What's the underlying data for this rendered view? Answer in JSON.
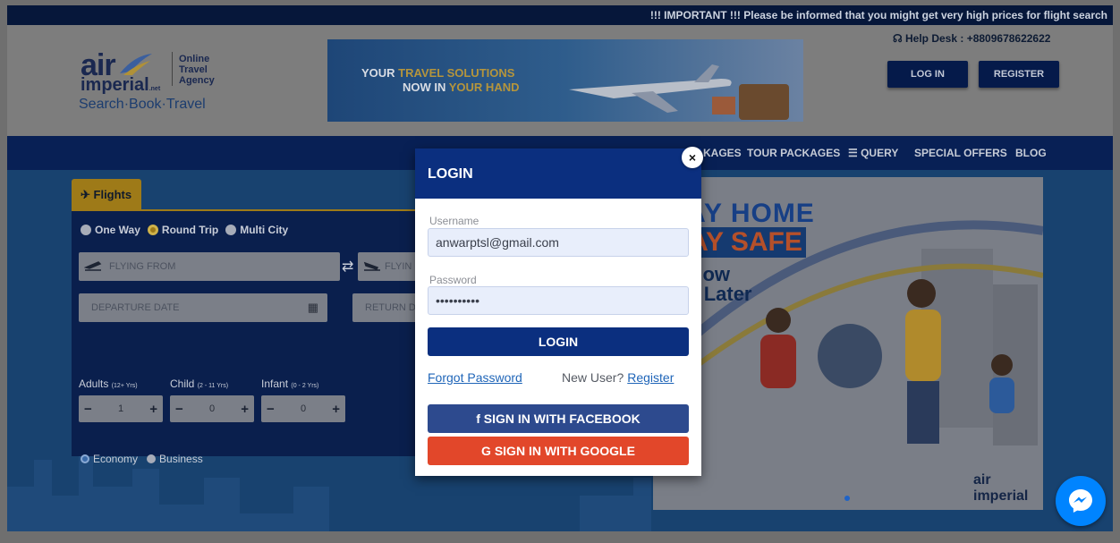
{
  "ticker": "!!! IMPORTANT !!! Please be informed that you might get very high prices for flight search",
  "header": {
    "logo": {
      "air": "air",
      "imperial": "imperial",
      "net": ".net",
      "ota": [
        "Online",
        "Travel",
        "Agency"
      ],
      "tagline": "Search·Book·Travel"
    },
    "banner": {
      "line1_a": "YOUR ",
      "line1_b": "TRAVEL SOLUTIONS",
      "line2_a": "NOW IN ",
      "line2_b": "YOUR HAND"
    },
    "helpdesk": "Help Desk : +8809678622622",
    "login_label": "LOG IN",
    "register_label": "REGISTER"
  },
  "nav": {
    "items": [
      "KAGES",
      "TOUR PACKAGES",
      "QUERY",
      "SPECIAL OFFERS",
      "BLOG"
    ]
  },
  "search": {
    "tab_label": "Flights",
    "trip_types": [
      "One Way",
      "Round Trip",
      "Multi City"
    ],
    "selected_trip": "Round Trip",
    "flying_from_placeholder": "FLYING FROM",
    "flying_to_placeholder": "FLYIN",
    "departure_placeholder": "DEPARTURE DATE",
    "return_placeholder": "RETURN D",
    "pax": {
      "adults_label": "Adults",
      "adults_range": "(12+ Yrs)",
      "adults_value": "1",
      "child_label": "Child",
      "child_range": "(2 - 11 Yrs)",
      "child_value": "0",
      "infant_label": "Infant",
      "infant_range": "(0 - 2 Yrs)",
      "infant_value": "0"
    },
    "classes": [
      "Economy",
      "Business"
    ],
    "selected_class": "Economy"
  },
  "promo": {
    "line1": "TAY HOME",
    "line2": "TAY SAFE",
    "line3": "n Now",
    "line4": "vel Later",
    "brand": "air imperial"
  },
  "modal": {
    "title": "LOGIN",
    "username_label": "Username",
    "username_value": "anwarptsl@gmail.com",
    "password_label": "Password",
    "password_value": "••••••••••",
    "submit_label": "LOGIN",
    "forgot_label": "Forgot Password",
    "new_user_label": "New User?",
    "register_label": "Register",
    "facebook_label": "f SIGN IN WITH FACEBOOK",
    "google_label": "G SIGN IN WITH GOOGLE",
    "close_label": "×"
  },
  "colors": {
    "navy": "#0b2f7f",
    "gold": "#9e7a18",
    "facebook": "#2d4a8e",
    "google": "#e2472a",
    "messenger": "#0084ff"
  }
}
